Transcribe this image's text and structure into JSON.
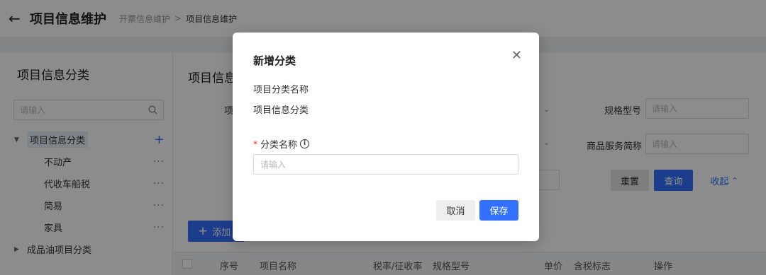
{
  "header": {
    "back_icon": "arrow-left-icon",
    "title": "项目信息维护",
    "breadcrumb": [
      "开票信息维护",
      ">",
      "项目信息维护"
    ]
  },
  "sidebar": {
    "title": "项目信息分类",
    "search_placeholder": "请输入",
    "tree": [
      {
        "label": "项目信息分类",
        "expanded": true,
        "children": [
          "不动产",
          "代收车船税",
          "简易",
          "家具"
        ]
      },
      {
        "label": "成品油项目分类",
        "expanded": false
      }
    ]
  },
  "main": {
    "title": "项目信息",
    "filters": {
      "left_label_partial": "项",
      "spec_label": "规格型号",
      "spec_placeholder": "请输入",
      "short_name_label": "商品服务简称",
      "short_name_placeholder": "请输入"
    },
    "buttons": {
      "reset": "重置",
      "query": "查询",
      "collapse": "收起",
      "add": "添加"
    },
    "table_headers": [
      "序号",
      "项目名称",
      "税率/征收率",
      "规格型号",
      "单价",
      "含税标志",
      "操作"
    ]
  },
  "modal": {
    "title": "新增分类",
    "parent_label": "项目分类名称",
    "parent_value": "项目信息分类",
    "field_label": "分类名称",
    "field_placeholder": "请输入",
    "cancel": "取消",
    "save": "保存"
  },
  "colors": {
    "primary": "#3370ff",
    "required": "#f5222d",
    "overlay": "rgba(0,0,0,0.45)"
  }
}
